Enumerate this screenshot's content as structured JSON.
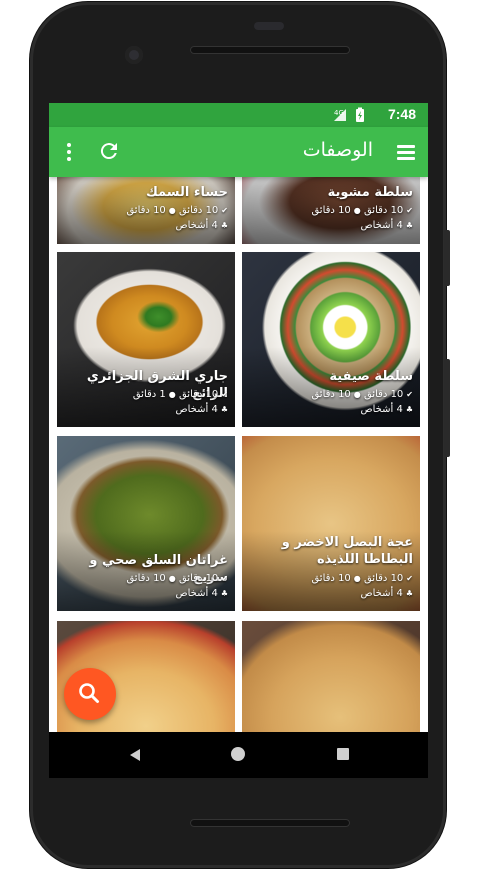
{
  "status": {
    "time": "7:48"
  },
  "appbar": {
    "title": "الوصفات"
  },
  "colors": {
    "statusbar": "#30a43e",
    "appbar": "#3fbc4d",
    "fab": "#ff5722"
  },
  "icons": {
    "menu": "hamburger-menu-icon",
    "refresh": "refresh-icon",
    "overflow": "overflow-menu-icon",
    "search": "search-icon"
  },
  "recipes": [
    {
      "title": "حساء السمك",
      "time": "10 دقائق",
      "prep": "10 دقائق",
      "servings": "4 أشخاص"
    },
    {
      "title": "سلطة مشوية",
      "time": "10 دقائق",
      "prep": "10 دقائق",
      "servings": "4 أشخاص"
    },
    {
      "title": "جاري الشرق الجزائري الرائع",
      "time": "10 دقائق",
      "prep": "1 دقائق",
      "servings": "4 أشخاص"
    },
    {
      "title": "سلطة صيفية",
      "time": "10 دقائق",
      "prep": "10 دقائق",
      "servings": "4 أشخاص"
    },
    {
      "title": "غراتان السلق صحي و سريع",
      "time": "10 دقائق",
      "prep": "10 دقائق",
      "servings": "4 أشخاص"
    },
    {
      "title": "عجة البصل الاخضر و البطاطا اللذيذه",
      "time": "10 دقائق",
      "prep": "10 دقائق",
      "servings": "4 أشخاص"
    },
    {
      "title": "",
      "time": "",
      "prep": "",
      "servings": ""
    },
    {
      "title": "",
      "time": "",
      "prep": "",
      "servings": ""
    }
  ]
}
